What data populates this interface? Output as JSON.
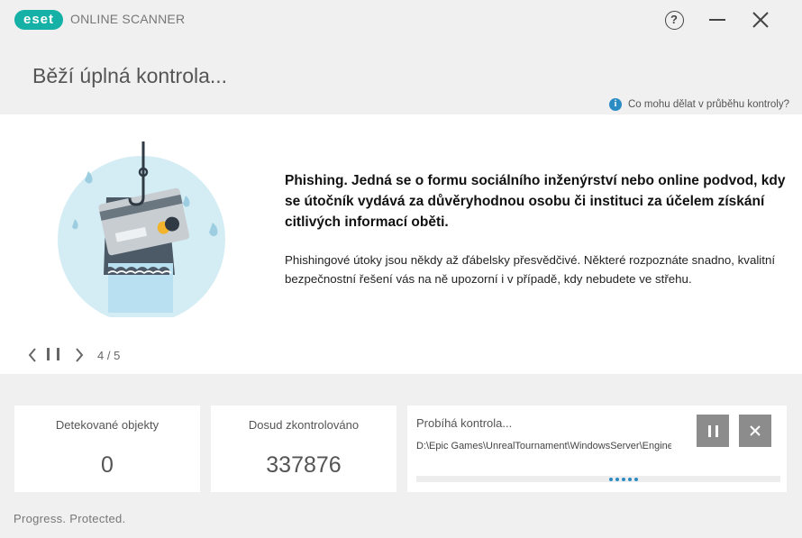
{
  "app": {
    "logo_text": "eset",
    "name": "ONLINE SCANNER",
    "help_glyph": "?",
    "colors": {
      "brand": "#15b1a6",
      "accent": "#2b8cc4",
      "button": "#8c8c8c"
    }
  },
  "header": {
    "title": "Běží úplná kontrola...",
    "help_link": "Co mohu dělat v průběhu kontroly?",
    "help_icon": "info-icon",
    "info_glyph": "i"
  },
  "slide": {
    "illustration": "phishing-card-hook",
    "headline": "Phishing. Jedná se o formu sociálního inženýrství nebo online podvod, kdy se útočník vydává za důvěryhodnou osobu či instituci za účelem získání citlivých informací oběti.",
    "body": "Phishingové útoky jsou někdy až ďábelsky přesvědčivé. Některé rozpoznáte snadno, kvalitní bezpečnostní řešení vás na ně upozorní i v případě, kdy nebudete ve střehu.",
    "counter": "4 / 5"
  },
  "stats": {
    "detected_label": "Detekované objekty",
    "detected_value": "0",
    "scanned_label": "Dosud zkontrolováno",
    "scanned_value": "337876"
  },
  "scan": {
    "title": "Probíhá kontrola...",
    "path": "D:\\Epic Games\\UnrealTournament\\WindowsServer\\Engine"
  },
  "footer": {
    "tagline": "Progress. Protected."
  }
}
